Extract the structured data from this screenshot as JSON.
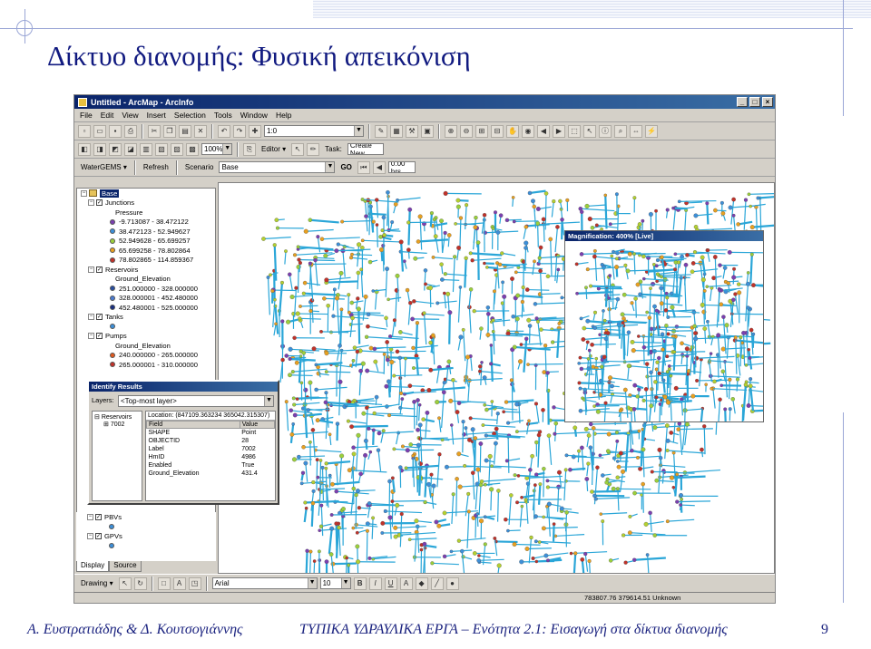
{
  "slide": {
    "title": "Δίκτυο διανομής: Φυσική απεικόνιση",
    "footer_authors": "Α. Ευστρατιάδης & Δ. Κουτσογιάννης",
    "footer_course": "ΤΥΠΙΚΑ ΥΔΡΑΥΛΙΚΑ ΕΡΓΑ – Ενότητα 2.1: Εισαγωγή στα δίκτυα διανομής",
    "page_number": "9"
  },
  "window": {
    "title": "Untitled - ArcMap - ArcInfo",
    "menu": [
      "File",
      "Edit",
      "View",
      "Insert",
      "Selection",
      "Tools",
      "Window",
      "Help"
    ]
  },
  "toolbars": {
    "scale_value": "1:0",
    "zoom_value": "100%",
    "editor_label": "Editor ▾",
    "task_label": "Task:",
    "task_value": "Create New",
    "watergems_label": "WaterGEMS ▾",
    "refresh_label": "Refresh",
    "scenario_label": "Scenario",
    "scenario_value": "Base",
    "go_label": "GO",
    "time_value": "0.00 hrs"
  },
  "toc": {
    "root": "Base",
    "layers": [
      {
        "kind": "layer",
        "label": "Junctions"
      },
      {
        "kind": "field",
        "label": "Pressure"
      },
      {
        "kind": "class",
        "label": "-9.713087 - 38.472122",
        "color": "#7b3fb0"
      },
      {
        "kind": "class",
        "label": "38.472123 - 52.949627",
        "color": "#3d8fd8"
      },
      {
        "kind": "class",
        "label": "52.949628 - 65.699257",
        "color": "#9bcf3b"
      },
      {
        "kind": "class",
        "label": "65.699258 - 78.802864",
        "color": "#e8a020"
      },
      {
        "kind": "class",
        "label": "78.802865 - 114.859367",
        "color": "#c0322a"
      },
      {
        "kind": "layer",
        "label": "Reservoirs"
      },
      {
        "kind": "field",
        "label": "Ground_Elevation"
      },
      {
        "kind": "class",
        "label": "251.000000 - 328.000000",
        "color": "#2a4fa0"
      },
      {
        "kind": "class",
        "label": "328.000001 - 452.480000",
        "color": "#4c7cd0"
      },
      {
        "kind": "class",
        "label": "452.480001 - 525.000000",
        "color": "#1a2f80"
      },
      {
        "kind": "layer",
        "label": "Tanks"
      },
      {
        "kind": "blank",
        "label": "",
        "color": "#3d8fd8"
      },
      {
        "kind": "layer",
        "label": "Pumps"
      },
      {
        "kind": "field",
        "label": "Ground_Elevation"
      },
      {
        "kind": "class",
        "label": "240.000000 - 265.000000",
        "color": "#e05a20"
      },
      {
        "kind": "class",
        "label": "265.000001 - 310.000000",
        "color": "#c0322a"
      }
    ],
    "lower_layers": [
      {
        "kind": "layer",
        "label": "PBVs"
      },
      {
        "kind": "layer",
        "label": "GPVs"
      }
    ],
    "tabs": [
      "Display",
      "Source"
    ]
  },
  "magnifier": {
    "title": "Magnification: 400% [Live]"
  },
  "identify": {
    "title": "Identify Results",
    "layers_label": "Layers:",
    "layers_value": "<Top-most layer>",
    "tree_root": "Reservoirs",
    "tree_child": "7002",
    "location": "Location: (847109.363234 365042.315307)",
    "columns": [
      "Field",
      "Value"
    ],
    "rows": [
      [
        "SHAPE",
        "Point"
      ],
      [
        "OBJECTID",
        "28"
      ],
      [
        "Label",
        "7002"
      ],
      [
        "HmID",
        "4986"
      ],
      [
        "Enabled",
        "True"
      ],
      [
        "Ground_Elevation",
        "431.4"
      ]
    ]
  },
  "drawing_bar": {
    "drawing_label": "Drawing ▾",
    "font": "Arial",
    "font_size": "10"
  },
  "status": {
    "coordinates": "783807.76  379614.51 Unknown"
  },
  "colors": {
    "pipe": "#2aa6d8",
    "title": "#111a80",
    "titlebar": "#0a246a"
  }
}
